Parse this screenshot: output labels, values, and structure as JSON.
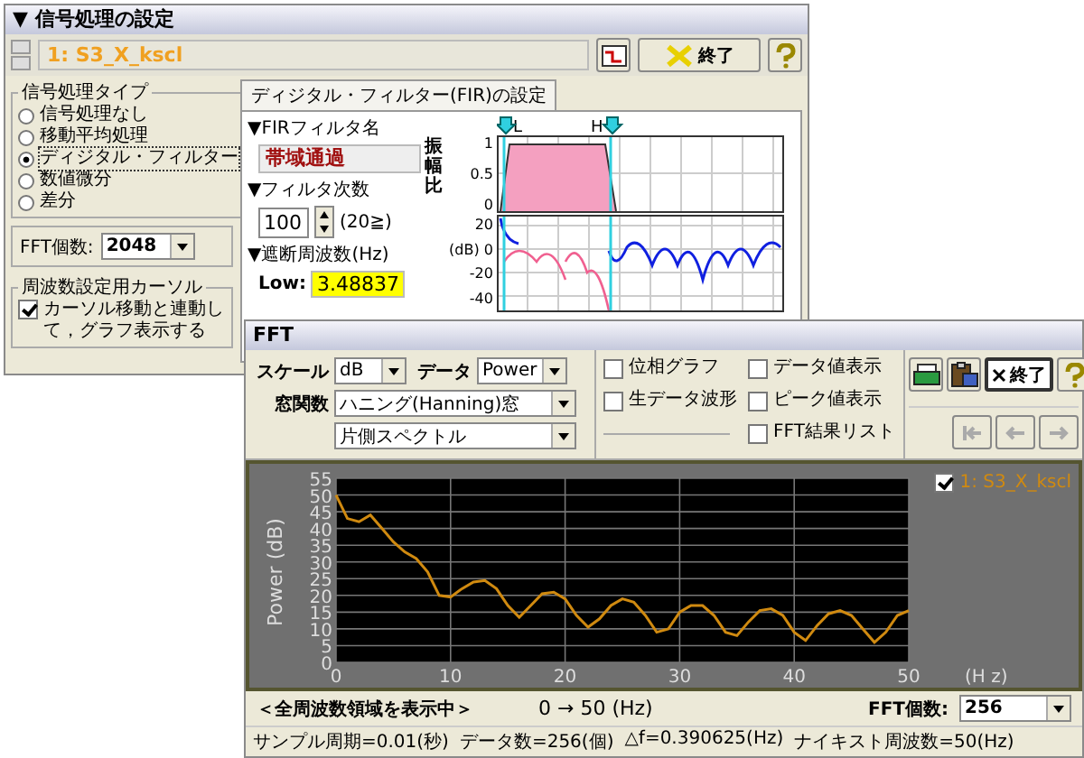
{
  "settings_window": {
    "title": "▼ 信号処理の設定",
    "series": "1: S3_X_kscl",
    "close_button": "終了",
    "signal_type": {
      "title": "信号処理タイプ",
      "options": [
        {
          "label": "信号処理なし",
          "selected": false
        },
        {
          "label": "移動平均処理",
          "selected": false
        },
        {
          "label": "ディジタル・フィルター",
          "selected": true
        },
        {
          "label": "数値微分",
          "selected": false
        },
        {
          "label": "差分",
          "selected": false
        }
      ]
    },
    "fft_count": {
      "label": "FFT個数:",
      "value": "2048"
    },
    "cursor": {
      "title": "周波数設定用カーソル",
      "label": "カーソル移動と連動して，グラフ表示する",
      "checked": true
    },
    "tab": "ディジタル・フィルター(FIR)の設定",
    "fir_name": {
      "label": "▼FIRフィルタ名",
      "value": "帯域通過"
    },
    "order": {
      "label": "▼フィルタ次数",
      "value": "100",
      "note": "(20≧)"
    },
    "cutoff": {
      "label": "▼遮断周波数(Hz)",
      "low_label": "Low:",
      "low_value": "3.48837"
    },
    "amplitude_plot": {
      "ylabel": "振幅比",
      "yticks": [
        "1",
        "0.5",
        "0"
      ],
      "cursors": [
        "L",
        "H"
      ]
    },
    "db_plot": {
      "yticks": [
        "20",
        "(dB) 0",
        "-20",
        "-40"
      ]
    }
  },
  "fft_window": {
    "title": "FFT",
    "scale": {
      "label": "スケール",
      "value": "dB"
    },
    "data": {
      "label": "データ",
      "value": "Power"
    },
    "window_function": {
      "label": "窓関数",
      "value": "ハニング(Hanning)窓"
    },
    "spectrum": {
      "value": "片側スペクトル"
    },
    "options": [
      {
        "label": "位相グラフ",
        "checked": false
      },
      {
        "label": "生データ波形",
        "checked": false
      },
      {
        "label": "データ値表示",
        "checked": false
      },
      {
        "label": "ピーク値表示",
        "checked": false
      },
      {
        "label": "FFT結果リスト",
        "checked": false
      }
    ],
    "close_button": "終了",
    "nav_buttons": [
      {
        "kind": "first",
        "disabled": true
      },
      {
        "kind": "prev",
        "disabled": true
      },
      {
        "kind": "next",
        "disabled": true
      }
    ],
    "legend": {
      "checked": true
    },
    "chart_data": {
      "type": "line",
      "xlabel": "(H z)",
      "ylabel": "Power (dB)",
      "grid": true,
      "xlim": [
        0,
        50
      ],
      "ylim": [
        0,
        55
      ],
      "xticks": [
        0,
        10,
        20,
        30,
        40,
        50
      ],
      "yticks": [
        0,
        5,
        10,
        15,
        20,
        25,
        30,
        35,
        40,
        45,
        50,
        55
      ],
      "x": [
        0,
        1,
        2,
        3,
        4,
        5,
        6,
        7,
        8,
        9,
        10,
        11,
        12,
        13,
        14,
        15,
        16,
        17,
        18,
        19,
        20,
        21,
        22,
        23,
        24,
        25,
        26,
        27,
        28,
        29,
        30,
        31,
        32,
        33,
        34,
        35,
        36,
        37,
        38,
        39,
        40,
        41,
        42,
        43,
        44,
        45,
        46,
        47,
        48,
        49,
        50
      ],
      "series": [
        {
          "name": "1: S3_X_kscl",
          "color": "#d08a10",
          "values": [
            50,
            43,
            42,
            44,
            40,
            36,
            33,
            31,
            27,
            20,
            19.5,
            22,
            24,
            24.5,
            22,
            17,
            13.5,
            17,
            20.5,
            21,
            19,
            14,
            10.5,
            13,
            17,
            19,
            18,
            14,
            9,
            10,
            15,
            17,
            17,
            14,
            9,
            8,
            12,
            15.5,
            16,
            14,
            9,
            6.5,
            11,
            14.5,
            15.5,
            14,
            10,
            6,
            9,
            14,
            15.5
          ]
        }
      ]
    },
    "range_message": "＜全周波数領域を表示中＞",
    "range": "0 → 50 (Hz)",
    "fft_count": {
      "label": "FFT個数:",
      "value": "256"
    },
    "status": [
      "サンプル周期=0.01(秒)",
      "データ数=256(個)",
      "△f=0.390625(Hz)",
      "ナイキスト周波数=50(Hz)"
    ]
  }
}
